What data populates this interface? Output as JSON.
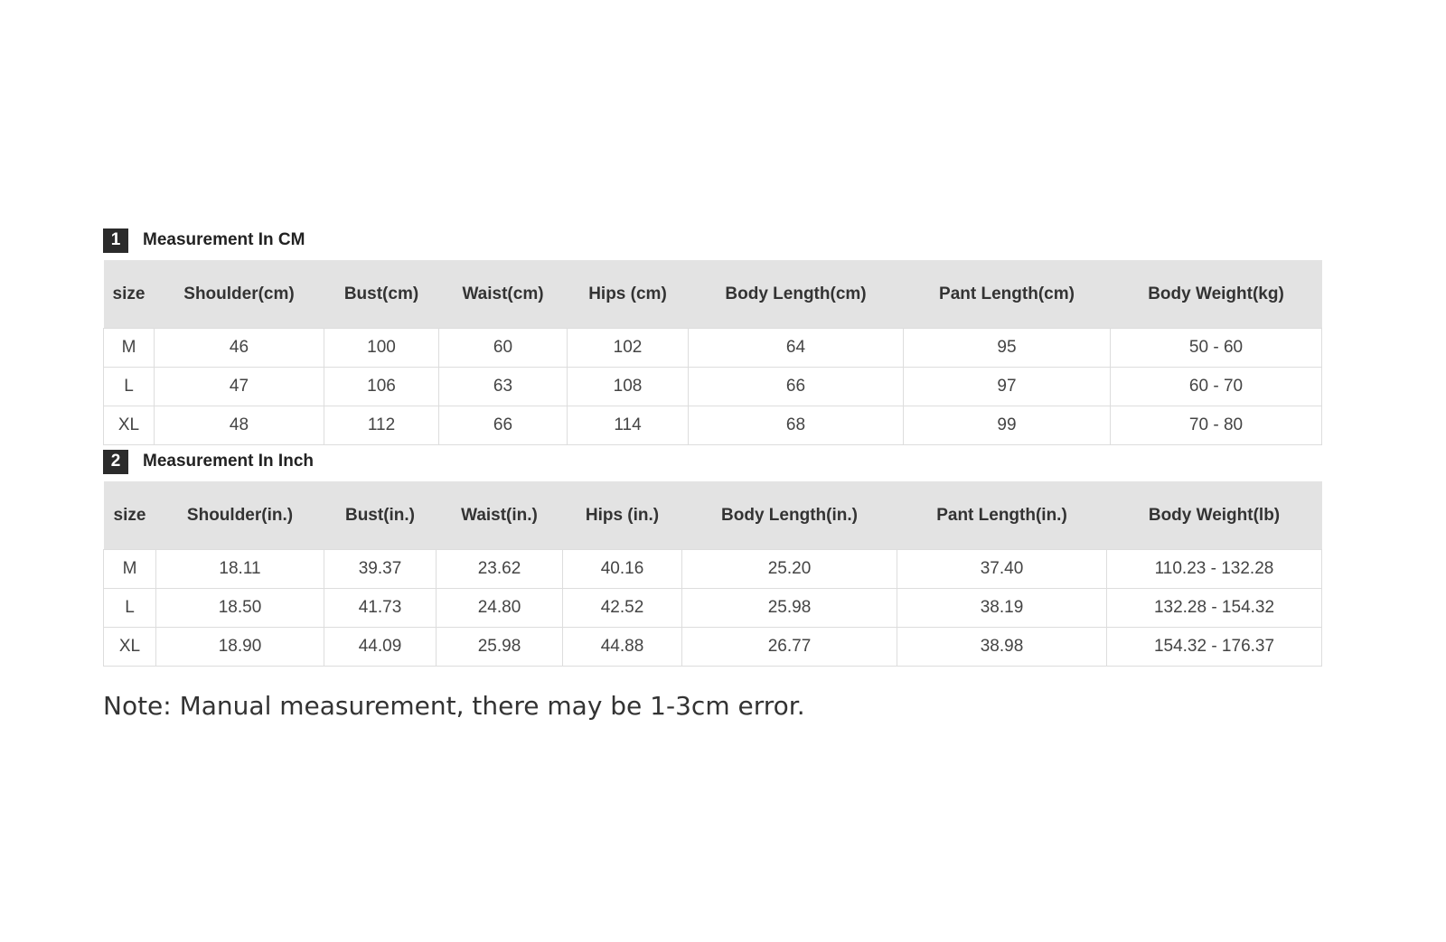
{
  "cm_section": {
    "number": "1",
    "title": "Measurement In CM",
    "headers": [
      "size",
      "Shoulder(cm)",
      "Bust(cm)",
      "Waist(cm)",
      "Hips (cm)",
      "Body Length(cm)",
      "Pant Length(cm)",
      "Body Weight(kg)"
    ],
    "rows": [
      [
        "M",
        "46",
        "100",
        "60",
        "102",
        "64",
        "95",
        "50 - 60"
      ],
      [
        "L",
        "47",
        "106",
        "63",
        "108",
        "66",
        "97",
        "60 - 70"
      ],
      [
        "XL",
        "48",
        "112",
        "66",
        "114",
        "68",
        "99",
        "70 - 80"
      ]
    ]
  },
  "inch_section": {
    "number": "2",
    "title": "Measurement In Inch",
    "headers": [
      "size",
      "Shoulder(in.)",
      "Bust(in.)",
      "Waist(in.)",
      "Hips (in.)",
      "Body Length(in.)",
      "Pant Length(in.)",
      "Body Weight(lb)"
    ],
    "rows": [
      [
        "M",
        "18.11",
        "39.37",
        "23.62",
        "40.16",
        "25.20",
        "37.40",
        "110.23 - 132.28"
      ],
      [
        "L",
        "18.50",
        "41.73",
        "24.80",
        "42.52",
        "25.98",
        "38.19",
        "132.28 - 154.32"
      ],
      [
        "XL",
        "18.90",
        "44.09",
        "25.98",
        "44.88",
        "26.77",
        "38.98",
        "154.32 - 176.37"
      ]
    ]
  },
  "note": "Note: Manual measurement, there may be 1-3cm error."
}
